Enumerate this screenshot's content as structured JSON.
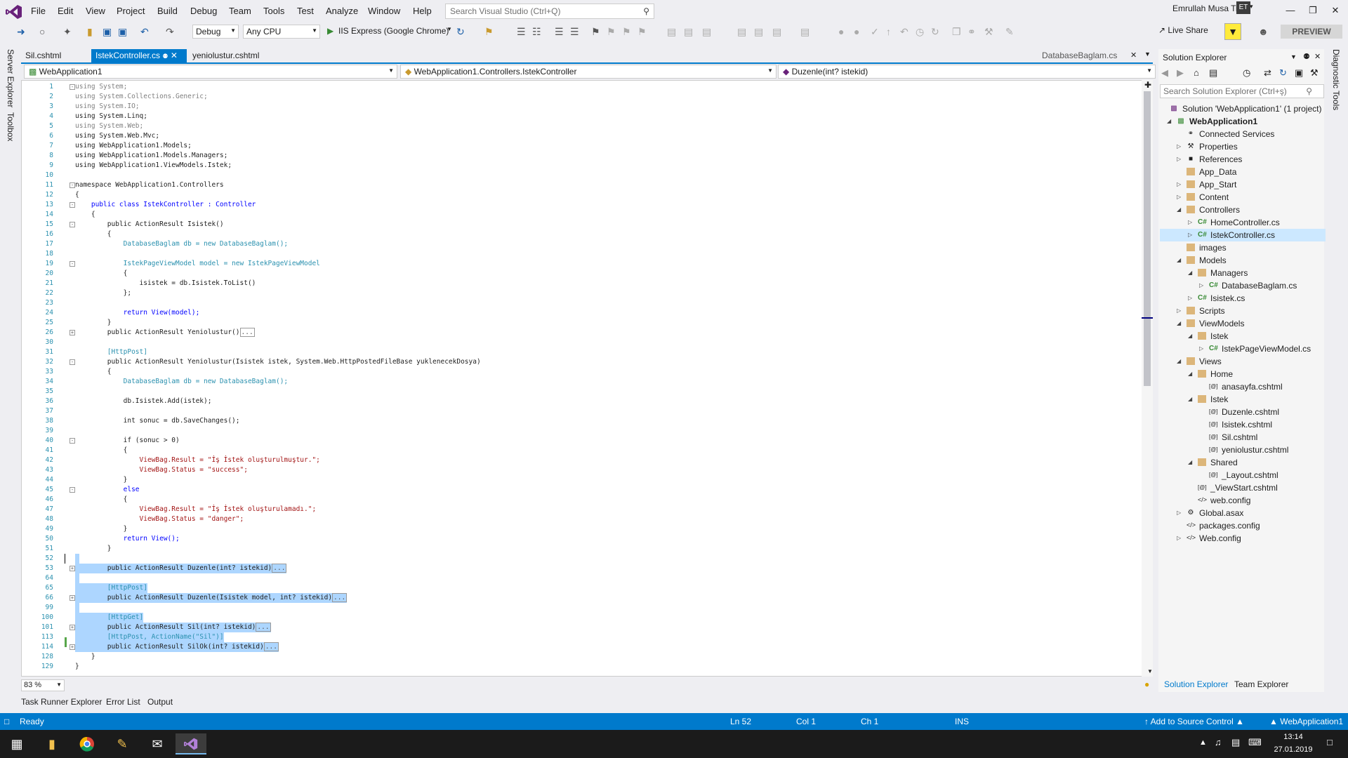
{
  "menu": {
    "items": [
      "File",
      "Edit",
      "View",
      "Project",
      "Build",
      "Debug",
      "Team",
      "Tools",
      "Test",
      "Analyze",
      "Window",
      "Help"
    ],
    "search_placeholder": "Search Visual Studio (Ctrl+Q)",
    "user_name": "Emrullah Musa Tilki",
    "user_initials": "ET"
  },
  "toolbar": {
    "config": "Debug",
    "platform": "Any CPU",
    "run_target": "IIS Express (Google Chrome)",
    "live_share": "Live Share",
    "preview": "PREVIEW"
  },
  "side": {
    "server_explorer": "Server Explorer",
    "toolbox": "Toolbox",
    "diagnostic_tools": "Diagnostic Tools"
  },
  "tabs": {
    "t1": "Sil.cshtml",
    "t2": "IstekController.cs",
    "t3": "yeniolustur.cshtml",
    "t4": "DatabaseBaglam.cs"
  },
  "nav": {
    "project": "WebApplication1",
    "class": "WebApplication1.Controllers.IstekController",
    "member": "Duzenle(int? istekid)"
  },
  "editor": {
    "zoom": "83 %"
  },
  "bottom": {
    "task_runner": "Task Runner Explorer",
    "error_list": "Error List",
    "output": "Output"
  },
  "solution_explorer": {
    "title": "Solution Explorer",
    "search_placeholder": "Search Solution Explorer (Ctrl+ş)",
    "tab_solution": "Solution Explorer",
    "tab_team": "Team Explorer",
    "items": [
      "Solution 'WebApplication1' (1 project)",
      "WebApplication1",
      "Connected Services",
      "Properties",
      "References",
      "App_Data",
      "App_Start",
      "Content",
      "Controllers",
      "HomeController.cs",
      "IstekController.cs",
      "images",
      "Models",
      "Managers",
      "DatabaseBaglam.cs",
      "Isistek.cs",
      "Scripts",
      "ViewModels",
      "Istek",
      "IstekPageViewModel.cs",
      "Views",
      "Home",
      "anasayfa.cshtml",
      "Istek",
      "Duzenle.cshtml",
      "Isistek.cshtml",
      "Sil.cshtml",
      "yeniolustur.cshtml",
      "Shared",
      "_Layout.cshtml",
      "_ViewStart.cshtml",
      "web.config",
      "Global.asax",
      "packages.config",
      "Web.config"
    ]
  },
  "status": {
    "ready": "Ready",
    "ln": "Ln 52",
    "col": "Col 1",
    "ch": "Ch 1",
    "ins": "INS",
    "source_control": "Add to Source Control",
    "project": "WebApplication1"
  },
  "taskbar": {
    "time": "13:14",
    "date": "27.01.2019"
  },
  "code": {
    "l1": "using System;",
    "l2": "using System.Collections.Generic;",
    "l3": "using System.IO;",
    "l4": "using System.Linq;",
    "l5": "using System.Web;",
    "l6": "using System.Web.Mvc;",
    "l7": "using WebApplication1.Models;",
    "l8": "using WebApplication1.Models.Managers;",
    "l9": "using WebApplication1.ViewModels.Istek;",
    "l11": "namespace WebApplication1.Controllers",
    "l12": "{",
    "l13": "    public class IstekController : Controller",
    "l14": "    {",
    "l15": "        public ActionResult Isistek()",
    "l16": "        {",
    "l17": "            DatabaseBaglam db = new DatabaseBaglam();",
    "l19": "            IstekPageViewModel model = new IstekPageViewModel",
    "l20": "            {",
    "l21": "                isistek = db.Isistek.ToList()",
    "l22": "            };",
    "l24": "            return View(model);",
    "l25": "        }",
    "l26": "        public ActionResult Yeniolustur()",
    "l31": "        [HttpPost]",
    "l32": "        public ActionResult Yeniolustur(Isistek istek, System.Web.HttpPostedFileBase yuklenecekDosya)",
    "l33": "        {",
    "l34": "            DatabaseBaglam db = new DatabaseBaglam();",
    "l36": "            db.Isistek.Add(istek);",
    "l38": "            int sonuc = db.SaveChanges();",
    "l40": "            if (sonuc > 0)",
    "l41": "            {",
    "l42": "                ViewBag.Result = \"İş İstek oluşturulmuştur.\";",
    "l43": "                ViewBag.Status = \"success\";",
    "l44": "            }",
    "l45": "            else",
    "l46": "            {",
    "l47": "                ViewBag.Result = \"İş İstek oluşturulamadı.\";",
    "l48": "                ViewBag.Status = \"danger\";",
    "l49": "            }",
    "l50": "            return View();",
    "l51": "        }",
    "l53": "        public ActionResult Duzenle(int? istekid)",
    "l65": "        [HttpPost]",
    "l66": "        public ActionResult Duzenle(Isistek model, int? istekid)",
    "l100": "        [HttpGet]",
    "l101": "        public ActionResult Sil(int? istekid)",
    "l113": "        [HttpPost, ActionName(\"Sil\")]",
    "l114": "        public ActionResult SilOk(int? istekid)",
    "l128": "    }",
    "l129": "}",
    "ellipsis": "..."
  },
  "line_numbers": [
    "1",
    "2",
    "3",
    "4",
    "5",
    "6",
    "7",
    "8",
    "9",
    "10",
    "11",
    "12",
    "13",
    "14",
    "15",
    "16",
    "17",
    "18",
    "19",
    "20",
    "21",
    "22",
    "23",
    "24",
    "25",
    "26",
    "30",
    "31",
    "32",
    "33",
    "34",
    "35",
    "36",
    "37",
    "38",
    "39",
    "40",
    "41",
    "42",
    "43",
    "44",
    "45",
    "46",
    "47",
    "48",
    "49",
    "50",
    "51",
    "52",
    "53",
    "64",
    "65",
    "66",
    "99",
    "100",
    "101",
    "113",
    "114",
    "128",
    "129"
  ]
}
